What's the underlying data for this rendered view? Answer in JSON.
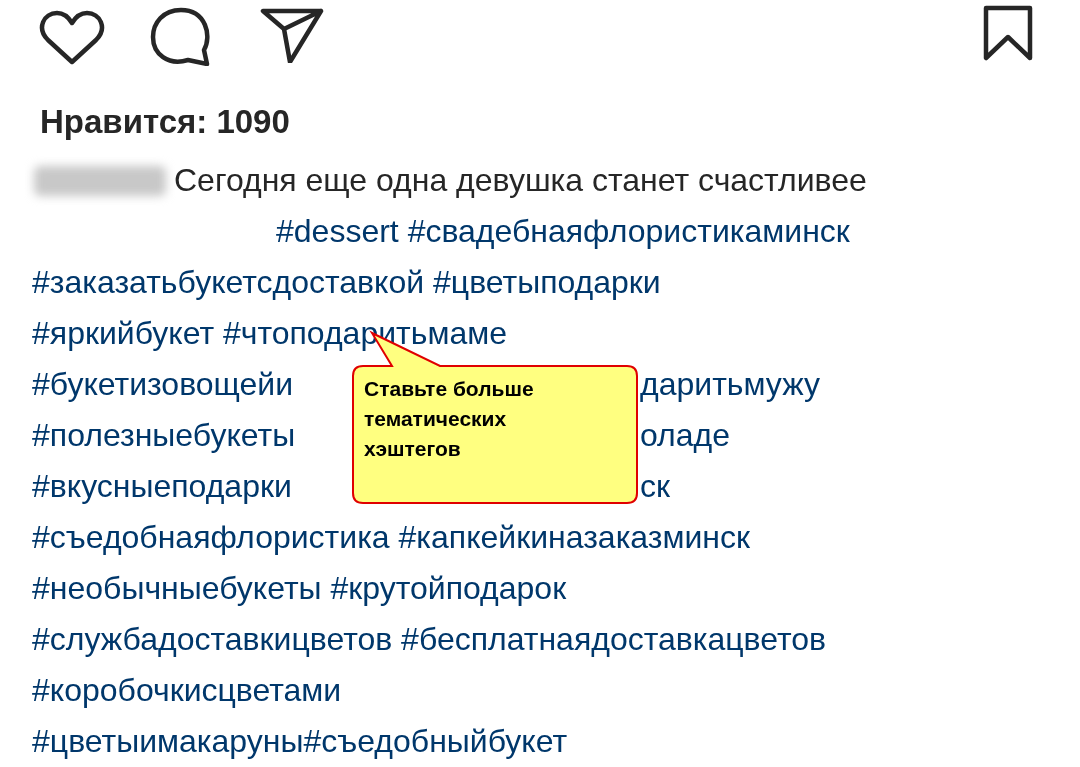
{
  "likes": "Нравится: 1090",
  "caption": {
    "text": "Сегодня еще одна девушка станет счастливее"
  },
  "hashtag_lines": [
    {
      "tags": [
        "#dessert",
        "#свадебнаяфлористикаминск"
      ]
    },
    {
      "tags": [
        "#заказатьбукетсдоставкой",
        "#цветыподарки"
      ]
    },
    {
      "tags": [
        "#яркийбукет",
        "#чтоподаритьмаме"
      ]
    },
    {
      "tags": [
        "#букетизовощейи"
      ],
      "tags_after": [
        "даритьмужу"
      ]
    },
    {
      "tags": [
        "#полезныебукеты"
      ],
      "tags_after": [
        "оладе"
      ]
    },
    {
      "tags": [
        "#вкусныеподарки"
      ],
      "tags_after": [
        "ск"
      ]
    },
    {
      "tags": [
        "#съедобнаяфлористика",
        "#капкейкиназаказминск"
      ]
    },
    {
      "tags": [
        "#необычныебукеты",
        "#крутойподарок"
      ]
    },
    {
      "tags": [
        "#службадоставкицветов",
        "#бесплатнаядоставкацветов"
      ]
    },
    {
      "tags": [
        "#коробочкисцветами"
      ]
    },
    {
      "tags": [
        "#цветыимакаруны#съедобныйбукет"
      ]
    }
  ],
  "callout": {
    "text": "Ставьте больше тематических хэштегов"
  }
}
